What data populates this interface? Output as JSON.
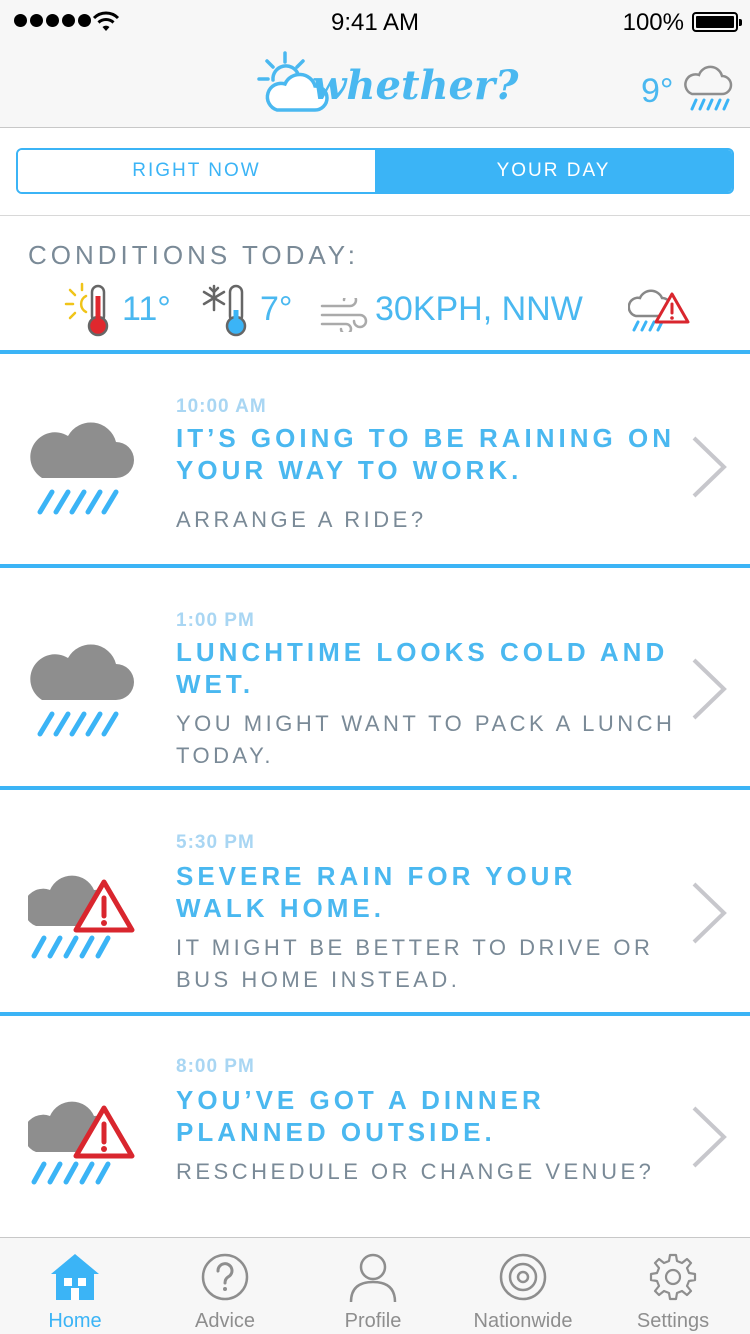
{
  "status_bar": {
    "time": "9:41 AM",
    "battery": "100%"
  },
  "header": {
    "logo_text": "whether?",
    "temperature": "9°",
    "weather_icon": "rain-cloud-icon"
  },
  "segment": {
    "left_label": "RIGHT NOW",
    "right_label": "YOUR DAY",
    "selected": "YOUR DAY"
  },
  "conditions": {
    "title": "CONDITIONS TODAY:",
    "high": "11°",
    "low": "7°",
    "wind": "30KPH, NNW",
    "alert_icon": "rain-warning-icon"
  },
  "cards": [
    {
      "time": "10:00 AM",
      "headline": "IT’S GOING TO BE RAINING ON YOUR WAY TO WORK.",
      "subtext": "ARRANGE A RIDE?",
      "icon": "rain-cloud-icon"
    },
    {
      "time": "1:00 PM",
      "headline": "LUNCHTIME LOOKS COLD AND WET.",
      "subtext": "YOU MIGHT WANT TO PACK A LUNCH TODAY.",
      "icon": "rain-cloud-icon"
    },
    {
      "time": "5:30 PM",
      "headline": "SEVERE RAIN FOR YOUR WALK HOME.",
      "subtext": "IT MIGHT BE BETTER TO DRIVE OR BUS HOME INSTEAD.",
      "icon": "severe-rain-warning-icon"
    },
    {
      "time": "8:00 PM",
      "headline": "YOU’VE GOT A DINNER PLANNED OUTSIDE.",
      "subtext": "RESCHEDULE OR CHANGE VENUE?",
      "icon": "severe-rain-warning-icon"
    }
  ],
  "tabbar": {
    "tabs": [
      {
        "label": "Home",
        "icon": "home-icon",
        "active": true
      },
      {
        "label": "Advice",
        "icon": "question-icon",
        "active": false
      },
      {
        "label": "Profile",
        "icon": "person-icon",
        "active": false
      },
      {
        "label": "Nationwide",
        "icon": "target-icon",
        "active": false
      },
      {
        "label": "Settings",
        "icon": "gear-icon",
        "active": false
      }
    ]
  },
  "colors": {
    "accent": "#3bb4f6",
    "text_muted": "#7a8a97",
    "alert": "#d9262e",
    "cloud": "#8e8e8e"
  }
}
